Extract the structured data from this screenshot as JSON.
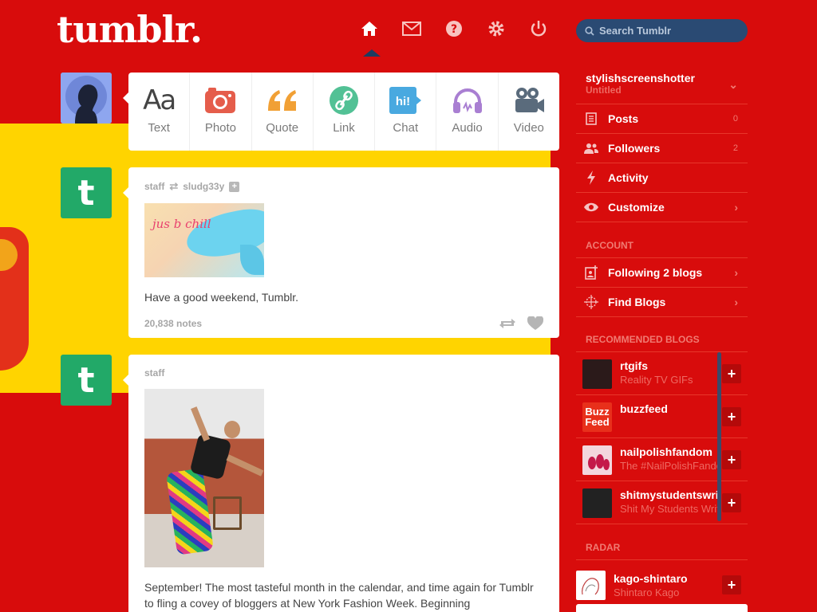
{
  "header": {
    "logo": "tumblr.",
    "nav": [
      {
        "name": "home-icon",
        "active": true
      },
      {
        "name": "mail-icon"
      },
      {
        "name": "help-icon"
      },
      {
        "name": "gear-icon"
      },
      {
        "name": "power-icon"
      }
    ],
    "search_placeholder": "Search Tumblr"
  },
  "composer": {
    "types": [
      {
        "label": "Text",
        "icon": "text-icon"
      },
      {
        "label": "Photo",
        "icon": "camera-icon"
      },
      {
        "label": "Quote",
        "icon": "quote-icon"
      },
      {
        "label": "Link",
        "icon": "link-icon"
      },
      {
        "label": "Chat",
        "icon": "chat-icon"
      },
      {
        "label": "Audio",
        "icon": "headphones-icon"
      },
      {
        "label": "Video",
        "icon": "video-camera-icon"
      }
    ]
  },
  "posts": [
    {
      "author": "staff",
      "reblogged_from": "sludg33y",
      "image_text": "jus b chill",
      "body": "Have a good weekend, Tumblr.",
      "notes": "20,838 notes"
    },
    {
      "author": "staff",
      "body": "September! The most tasteful month in the calendar, and time again for Tumblr to fling a covey of bloggers at New York Fashion Week. Beginning"
    }
  ],
  "sidebar": {
    "blog": {
      "name": "stylishscreenshotter",
      "subtitle": "Untitled"
    },
    "items": [
      {
        "label": "Posts",
        "count": "0",
        "icon": "posts-icon"
      },
      {
        "label": "Followers",
        "count": "2",
        "icon": "followers-icon"
      },
      {
        "label": "Activity",
        "icon": "activity-icon"
      },
      {
        "label": "Customize",
        "icon": "eye-icon"
      }
    ],
    "account_title": "ACCOUNT",
    "account_items": [
      {
        "label": "Following 2 blogs",
        "icon": "following-icon"
      },
      {
        "label": "Find Blogs",
        "icon": "find-blogs-icon"
      }
    ],
    "recommended_title": "RECOMMENDED BLOGS",
    "recommended": [
      {
        "name": "rtgifs",
        "subtitle": "Reality TV GIFs",
        "color": "#2b1a1a"
      },
      {
        "name": "buzzfeed",
        "subtitle": "",
        "color": "#e8301b",
        "thumb_text": "Buzz Feed"
      },
      {
        "name": "nailpolishfandom",
        "subtitle": "The #NailPolishFandom",
        "color": "#f3d6dd"
      },
      {
        "name": "shitmystudentswrite",
        "subtitle": "Shit My Students Write",
        "color": "#222222"
      }
    ],
    "radar_title": "RADAR",
    "radar": {
      "name": "kago-shintaro",
      "subtitle": "Shintaro Kago"
    }
  },
  "colors": {
    "background": "#d80c0c",
    "accent_yellow": "#ffd400",
    "search_bg": "#2a4a73",
    "tumblr_green": "#22a968"
  }
}
